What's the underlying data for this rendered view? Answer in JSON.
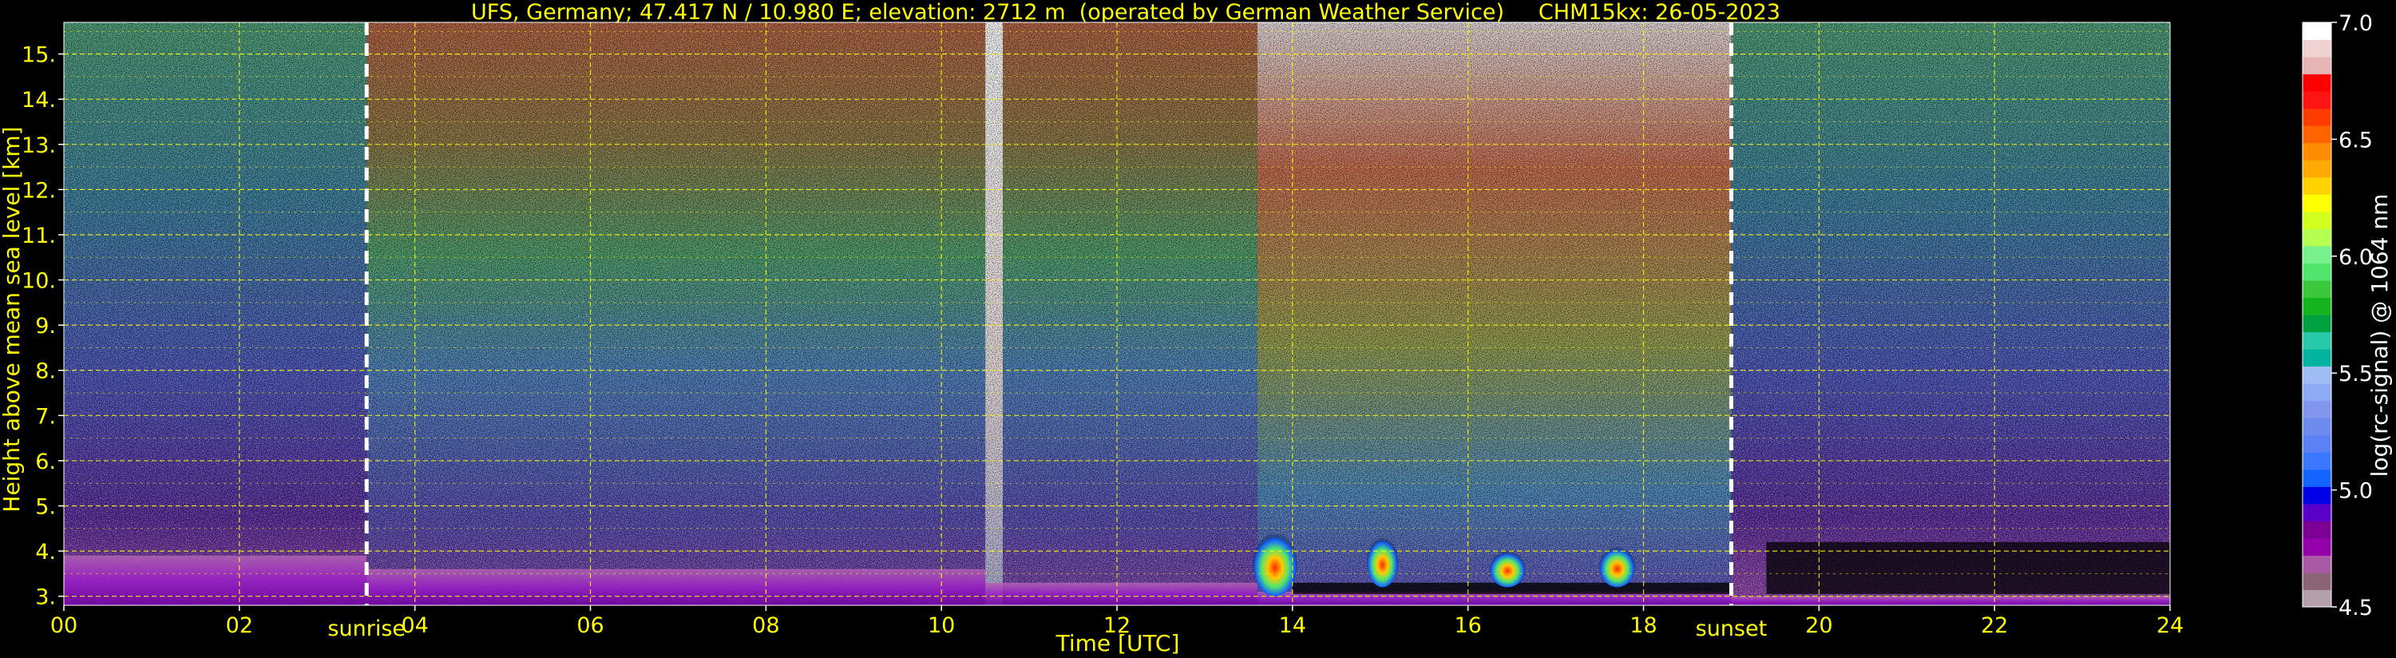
{
  "chart_data": {
    "type": "heatmap",
    "title": "UFS, Germany; 47.417 N / 10.980 E; elevation: 2712 m  (operated by German Weather Service)     CHM15kx: 26-05-2023",
    "xlabel": "Time [UTC]",
    "ylabel": "Height above mean sea level [km]",
    "xlim": [
      0,
      24
    ],
    "ylim": [
      2.8,
      15.7
    ],
    "x_ticks": [
      "00",
      "02",
      "04",
      "06",
      "08",
      "10",
      "12",
      "14",
      "16",
      "18",
      "20",
      "22",
      "24"
    ],
    "y_ticks": [
      "3.",
      "4.",
      "5.",
      "6.",
      "7.",
      "8.",
      "9.",
      "10.",
      "11.",
      "12.",
      "13.",
      "14.",
      "15."
    ],
    "grid": true,
    "annotations": [
      {
        "label": "sunrise",
        "x": 3.45
      },
      {
        "label": "sunset",
        "x": 19.0
      }
    ],
    "colorbar": {
      "label": "log(rc-signal) @ 1064 nm",
      "range": [
        4.5,
        7.0
      ],
      "ticks": [
        "4.5",
        "5.0",
        "5.5",
        "6.0",
        "6.5",
        "7.0"
      ],
      "colors": [
        "#b4a0aa",
        "#8c6478",
        "#aa5aa5",
        "#9400aa",
        "#7d0096",
        "#5a00c8",
        "#0000e6",
        "#1464ff",
        "#3c78ff",
        "#5a82f5",
        "#6e8cf0",
        "#8296f0",
        "#8caaf5",
        "#a0bef5",
        "#00b4a0",
        "#28c8aa",
        "#00a040",
        "#14b41e",
        "#3cc83c",
        "#50e66e",
        "#78f08c",
        "#b4ff50",
        "#d2ff1e",
        "#ffff00",
        "#ffd200",
        "#ffaa00",
        "#ff8c00",
        "#ff6400",
        "#ff3c00",
        "#ff1414",
        "#ff0000",
        "#e6b4b4",
        "#f0d2d2",
        "#ffffff"
      ]
    },
    "regime": [
      {
        "x": [
          0,
          3.45
        ],
        "bl": 3.9,
        "col": "low"
      },
      {
        "x": [
          3.45,
          10.5
        ],
        "bl": 3.6,
        "col": "warm"
      },
      {
        "x": [
          10.5,
          10.7
        ],
        "bl": 3.3,
        "col": "white"
      },
      {
        "x": [
          10.7,
          13.6
        ],
        "bl": 3.3,
        "col": "warm"
      },
      {
        "x": [
          13.6,
          19.0
        ],
        "bl": 3.1,
        "col": "hot"
      },
      {
        "x": [
          19.0,
          24
        ],
        "bl": 3.0,
        "col": "low"
      }
    ],
    "clouds": [
      {
        "x": [
          13.6,
          14.0
        ],
        "y": [
          3.0,
          4.4
        ]
      },
      {
        "x": [
          14.9,
          15.15
        ],
        "y": [
          3.2,
          4.3
        ]
      },
      {
        "x": [
          16.3,
          16.6
        ],
        "y": [
          3.2,
          4.0
        ]
      },
      {
        "x": [
          17.55,
          17.85
        ],
        "y": [
          3.2,
          4.1
        ]
      }
    ]
  }
}
